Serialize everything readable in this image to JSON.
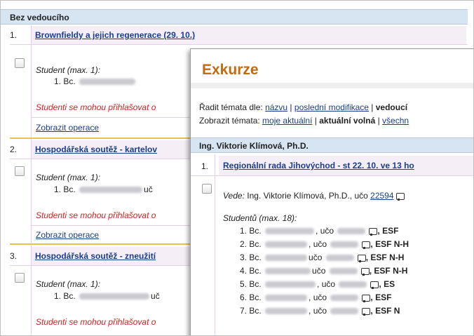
{
  "section_title": "Bez vedoucího",
  "rows": [
    {
      "num": "1.",
      "title": "Brownfieldy a jejich regenerace (29. 10.)",
      "student_label": "Student (max. 1):",
      "student_item": "1. Bc.",
      "student_suffix": "",
      "notice": "Studenti se mohou přihlašovat o",
      "operations": "Zobrazit operace"
    },
    {
      "num": "2.",
      "title": "Hospodářská soutěž - kartelov",
      "student_label": "Student (max. 1):",
      "student_item": "1. Bc.",
      "student_suffix": "uč",
      "notice": "Studenti se mohou přihlašovat o",
      "operations": "Zobrazit operace"
    },
    {
      "num": "3.",
      "title": "Hospodářská soutěž - zneužití",
      "student_label": "Student (max. 1):",
      "student_item": "1. Bc.",
      "student_suffix": "uč",
      "notice": "Studenti se mohou přihlašovat o",
      "operations": ""
    }
  ],
  "popup": {
    "title": "Exkurze",
    "sort_label": "Řadit témata dle:",
    "sort_links": [
      "názvu",
      "poslední modifikace"
    ],
    "sort_current": "vedoucí",
    "show_label": "Zobrazit témata:",
    "show_links": [
      "moje aktuální"
    ],
    "show_current": "aktuální volná",
    "show_last": "všechn",
    "section_title": "Ing. Viktorie Klímová, Ph.D.",
    "topic_num": "1.",
    "topic_title": "Regionální rada Jihovýchod - st 22. 10. ve 13 ho",
    "leader_label": "Vede:",
    "leader_name": "Ing. Viktorie Klímová, Ph.D., učo",
    "leader_uco": "22594",
    "students_label": "Studentů (max. 18):",
    "students": [
      {
        "num": "1.",
        "pre": "Bc.",
        "mid": ", učo",
        "post": ", ESF"
      },
      {
        "num": "2.",
        "pre": "Bc.",
        "mid": ", učo",
        "post": ", ESF N-H"
      },
      {
        "num": "3.",
        "pre": "Bc.",
        "mid": "učo",
        "post": ", ESF N-H"
      },
      {
        "num": "4.",
        "pre": "Bc.",
        "mid": "učo",
        "post": ", ESF N-H"
      },
      {
        "num": "5.",
        "pre": "Bc.",
        "mid": ", učo",
        "post": ", ES"
      },
      {
        "num": "6.",
        "pre": "Bc.",
        "mid": ", učo",
        "post": ", ESF"
      },
      {
        "num": "7.",
        "pre": "Bc.",
        "mid": ", učo",
        "post": ", ESF N"
      }
    ]
  }
}
